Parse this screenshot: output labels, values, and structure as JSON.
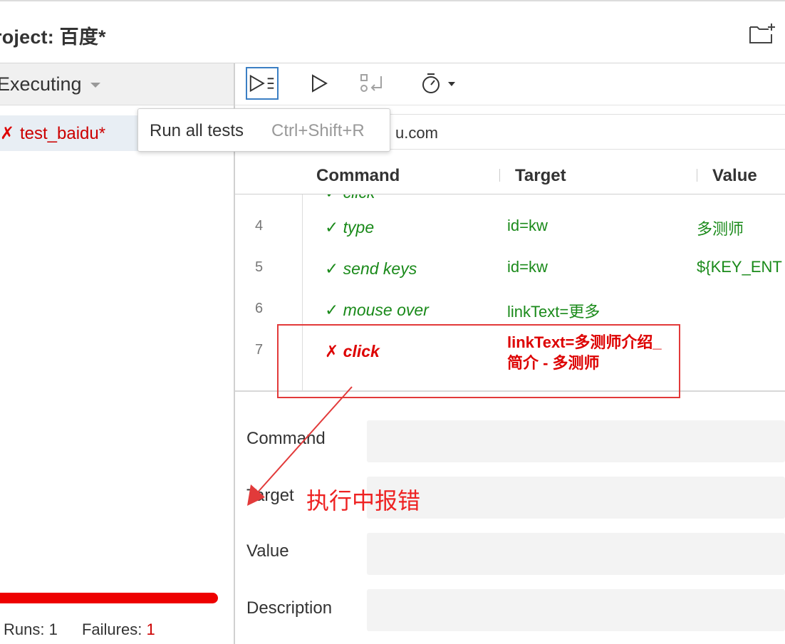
{
  "header": {
    "project_title": "roject:  百度*",
    "new_folder_icon": "folder-plus-icon"
  },
  "left_panel": {
    "executing_label": "Executing",
    "test": {
      "status_icon": "✗",
      "name": "test_baidu*"
    },
    "runs_label": "Runs:",
    "runs_value": "1",
    "failures_label": "Failures:",
    "failures_value": "1",
    "progress_color": "#e00000"
  },
  "toolbar": {
    "buttons": [
      "run-all-tests-icon",
      "run-current-test-icon",
      "record-icon",
      "speed-timer-icon"
    ]
  },
  "tooltip": {
    "label": "Run all tests",
    "shortcut": "Ctrl+Shift+R"
  },
  "url_bar": {
    "visible_text": "u.com"
  },
  "table": {
    "headers": {
      "command": "Command",
      "target": "Target",
      "value": "Value"
    },
    "partial_row": "✓ click",
    "rows": [
      {
        "num": "4",
        "status": "✓",
        "command": "type",
        "target": "id=kw",
        "value": "多测师"
      },
      {
        "num": "5",
        "status": "✓",
        "command": "send keys",
        "target": "id=kw",
        "value": "${KEY_ENT"
      },
      {
        "num": "6",
        "status": "✓",
        "command": "mouse over",
        "target": "linkText=更多",
        "value": ""
      },
      {
        "num": "7",
        "status": "✗",
        "command": "click",
        "target": "linkText=多测师介绍_简介 - 多测师",
        "value": ""
      }
    ]
  },
  "form": {
    "command_label": "Command",
    "target_label": "Target",
    "value_label": "Value",
    "description_label": "Description"
  },
  "annotation": {
    "text": "执行中报错",
    "color": "#e22222"
  }
}
